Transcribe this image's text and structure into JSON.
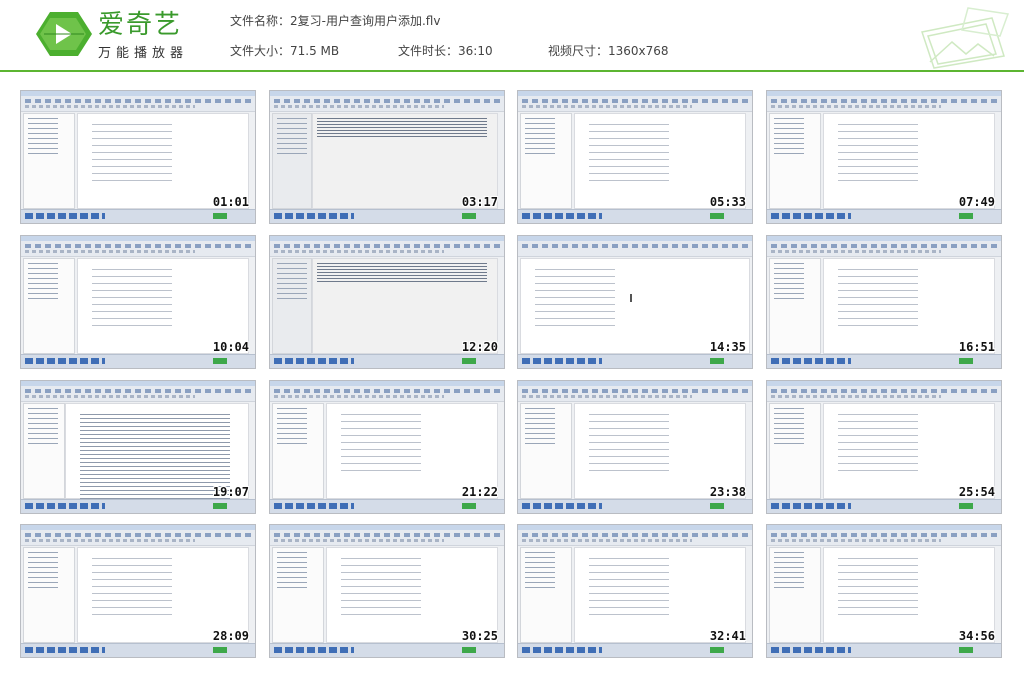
{
  "header": {
    "brand_name": "爱奇艺",
    "brand_sub": "万能播放器",
    "file_name": "文件名称：2复习-用户查询用户添加.flv",
    "file_size": "文件大小：71.5 MB",
    "duration": "文件时长：36:10",
    "video_size": "视频尺寸：1360x768",
    "accent_color": "#5cb531"
  },
  "thumbnails": [
    {
      "time": "01:01",
      "kind": "word"
    },
    {
      "time": "03:17",
      "kind": "sql"
    },
    {
      "time": "05:33",
      "kind": "word"
    },
    {
      "time": "07:49",
      "kind": "word"
    },
    {
      "time": "10:04",
      "kind": "word"
    },
    {
      "time": "12:20",
      "kind": "sql"
    },
    {
      "time": "14:35",
      "kind": "browser"
    },
    {
      "time": "16:51",
      "kind": "word"
    },
    {
      "time": "19:07",
      "kind": "ide"
    },
    {
      "time": "21:22",
      "kind": "word"
    },
    {
      "time": "23:38",
      "kind": "word"
    },
    {
      "time": "25:54",
      "kind": "word"
    },
    {
      "time": "28:09",
      "kind": "word"
    },
    {
      "time": "30:25",
      "kind": "word"
    },
    {
      "time": "32:41",
      "kind": "word"
    },
    {
      "time": "34:56",
      "kind": "word"
    }
  ]
}
